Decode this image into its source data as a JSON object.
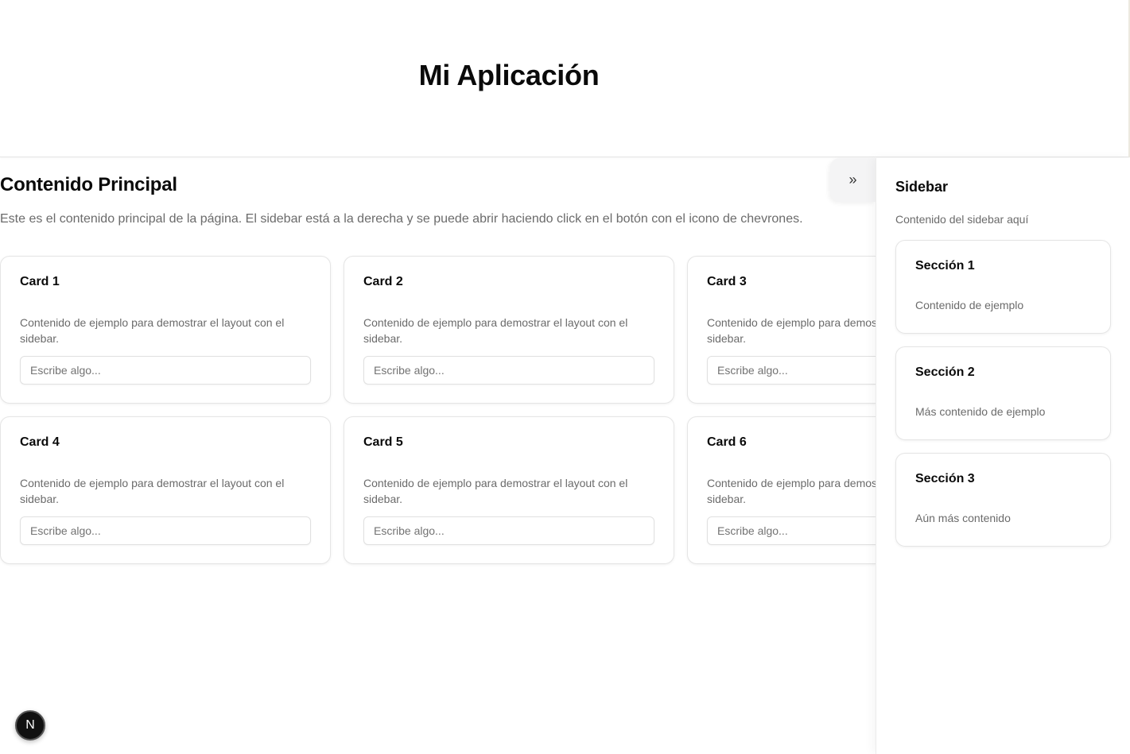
{
  "header": {
    "title": "Mi Aplicación"
  },
  "main": {
    "title": "Contenido Principal",
    "description": "Este es el contenido principal de la página. El sidebar está a la derecha y se puede abrir haciendo click en el botón con el icono de chevrones.",
    "cards": [
      {
        "title": "Card 1",
        "text": "Contenido de ejemplo para demostrar el layout con el sidebar.",
        "placeholder": "Escribe algo..."
      },
      {
        "title": "Card 2",
        "text": "Contenido de ejemplo para demostrar el layout con el sidebar.",
        "placeholder": "Escribe algo..."
      },
      {
        "title": "Card 3",
        "text": "Contenido de ejemplo para demostrar el layout con el sidebar.",
        "placeholder": "Escribe algo..."
      },
      {
        "title": "Card 4",
        "text": "Contenido de ejemplo para demostrar el layout con el sidebar.",
        "placeholder": "Escribe algo..."
      },
      {
        "title": "Card 5",
        "text": "Contenido de ejemplo para demostrar el layout con el sidebar.",
        "placeholder": "Escribe algo..."
      },
      {
        "title": "Card 6",
        "text": "Contenido de ejemplo para demostrar el layout con el sidebar.",
        "placeholder": "Escribe algo..."
      }
    ]
  },
  "toggle": {
    "icon": "chevrons-right-icon",
    "glyph": "»"
  },
  "sidebar": {
    "title": "Sidebar",
    "subtitle": "Contenido del sidebar aquí",
    "sections": [
      {
        "title": "Sección 1",
        "text": "Contenido de ejemplo"
      },
      {
        "title": "Sección 2",
        "text": "Más contenido de ejemplo"
      },
      {
        "title": "Sección 3",
        "text": "Aún más contenido"
      }
    ]
  },
  "dev_badge": {
    "letter": "N"
  },
  "colors": {
    "muted_text": "#6b6b6b",
    "border": "#e5e5e5",
    "toggle_bg": "#f4f4f5"
  }
}
